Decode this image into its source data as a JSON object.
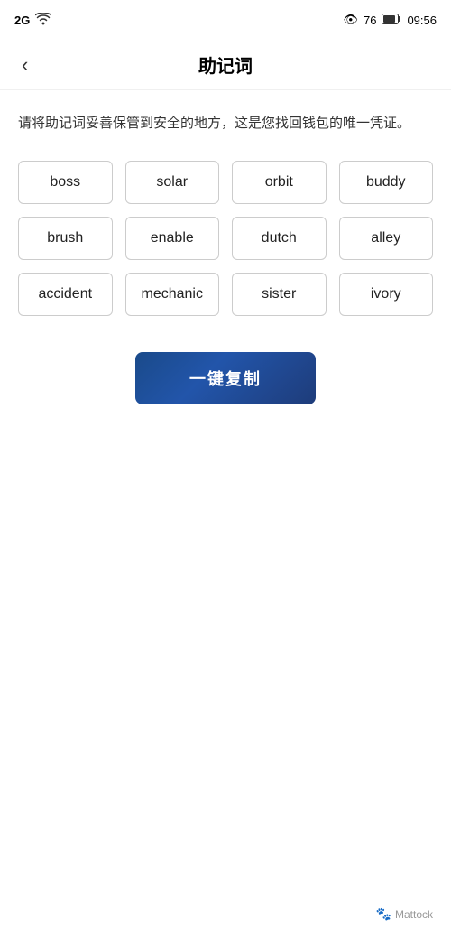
{
  "statusBar": {
    "signal": "2G",
    "wifi": "wifi",
    "eyeIcon": "👁",
    "battery": "76",
    "time": "09:56"
  },
  "header": {
    "backLabel": "‹",
    "title": "助记词"
  },
  "description": "请将助记词妥善保管到安全的地方，这是您找回钱包的唯一凭证。",
  "mnemonicWords": [
    "boss",
    "solar",
    "orbit",
    "buddy",
    "brush",
    "enable",
    "dutch",
    "alley",
    "accident",
    "mechanic",
    "sister",
    "ivory"
  ],
  "copyButton": {
    "label": "一键复制"
  },
  "watermark": {
    "icon": "🐾",
    "text": "Mattock"
  }
}
